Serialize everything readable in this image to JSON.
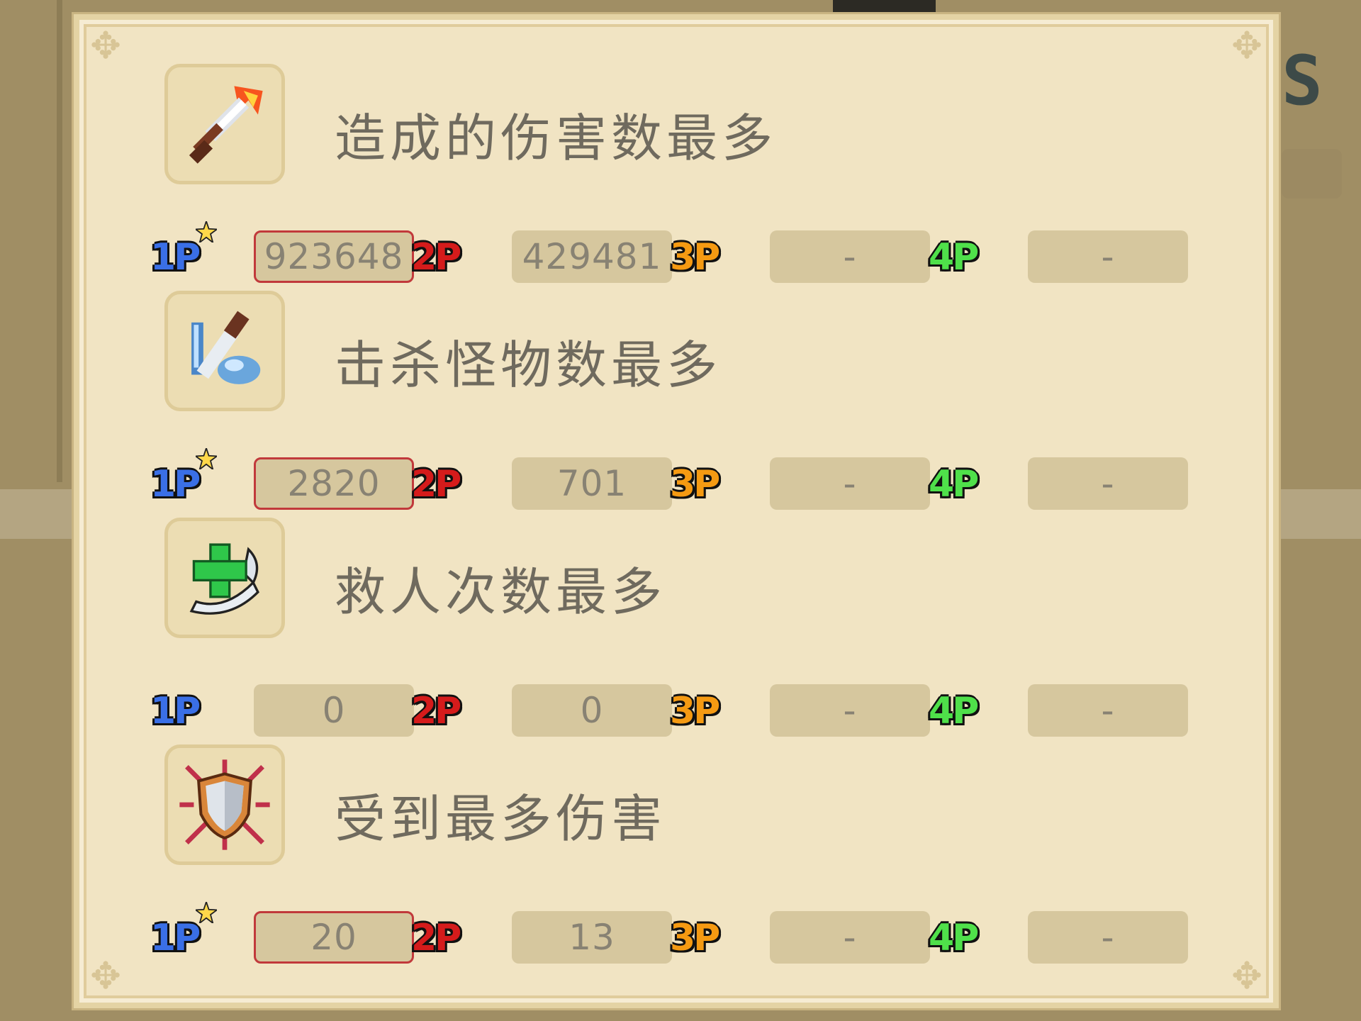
{
  "scene": {
    "colors": {
      "background": "#a08e64",
      "panel": "#f1e4c3",
      "value_box": "#d6c79e",
      "highlight_border": "#c1393b"
    }
  },
  "players": {
    "p1": "1P",
    "p2": "2P",
    "p3": "3P",
    "p4": "4P"
  },
  "categories": [
    {
      "icon": "flaming-sword-icon",
      "title": "造成的伤害数最多",
      "values": {
        "p1": "923648",
        "p2": "429481",
        "p3": "-",
        "p4": "-"
      },
      "best": "p1"
    },
    {
      "icon": "sword-and-gauntlet-icon",
      "title": "击杀怪物数最多",
      "values": {
        "p1": "2820",
        "p2": "701",
        "p3": "-",
        "p4": "-"
      },
      "best": "p1"
    },
    {
      "icon": "healing-cross-icon",
      "title": "救人次数最多",
      "values": {
        "p1": "0",
        "p2": "0",
        "p3": "-",
        "p4": "-"
      },
      "best": ""
    },
    {
      "icon": "shield-burst-icon",
      "title": "受到最多伤害",
      "values": {
        "p1": "20",
        "p2": "13",
        "p3": "-",
        "p4": "-"
      },
      "best": "p1"
    }
  ]
}
